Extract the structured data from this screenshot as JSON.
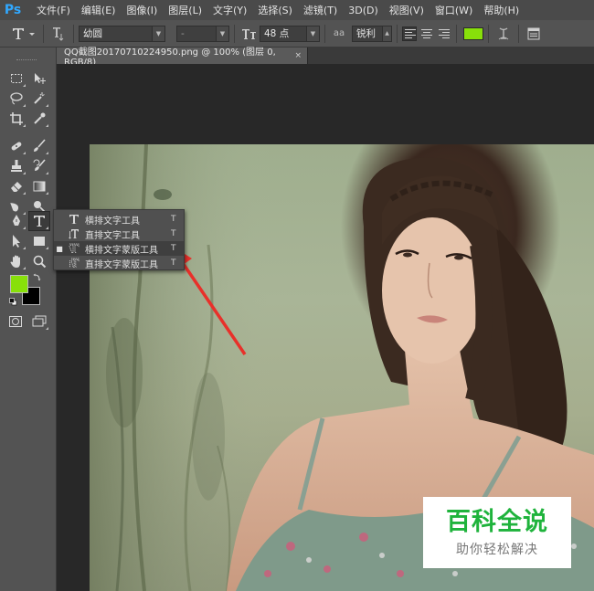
{
  "menubar": {
    "logo": "Ps",
    "items": [
      {
        "label": "文件(F)"
      },
      {
        "label": "编辑(E)"
      },
      {
        "label": "图像(I)"
      },
      {
        "label": "图层(L)"
      },
      {
        "label": "文字(Y)"
      },
      {
        "label": "选择(S)"
      },
      {
        "label": "滤镜(T)"
      },
      {
        "label": "3D(D)"
      },
      {
        "label": "视图(V)"
      },
      {
        "label": "窗口(W)"
      },
      {
        "label": "帮助(H)"
      }
    ]
  },
  "options": {
    "font_family": "幼圆",
    "font_style": "-",
    "font_size": "48 点",
    "aa_label": "aa",
    "antialias": "锐利",
    "text_color": "#88e00a"
  },
  "document": {
    "tab_title": "QQ截图20170710224950.png @ 100% (图层 0, RGB/8)",
    "close_symbol": "×"
  },
  "toolbar": {
    "foreground_color": "#88e00a",
    "background_color": "#000000"
  },
  "flyout": {
    "items": [
      {
        "label": "横排文字工具",
        "shortcut": "T",
        "icon": "horizontal-type-icon",
        "selected": false
      },
      {
        "label": "直排文字工具",
        "shortcut": "T",
        "icon": "vertical-type-icon",
        "selected": false
      },
      {
        "label": "横排文字蒙版工具",
        "shortcut": "T",
        "icon": "horizontal-type-mask-icon",
        "selected": true
      },
      {
        "label": "直排文字蒙版工具",
        "shortcut": "T",
        "icon": "vertical-type-mask-icon",
        "selected": false
      }
    ]
  },
  "watermark": {
    "title": "百科全说",
    "subtitle": "助你轻松解决"
  },
  "annotation": {
    "arrow_color": "#e8302a"
  }
}
